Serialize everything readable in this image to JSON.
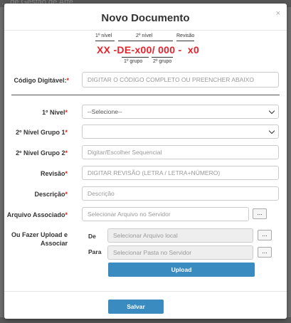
{
  "background": {
    "title": "... de Gestão de Arte"
  },
  "modal": {
    "title": "Novo Documento",
    "close": "×"
  },
  "code_guide": {
    "label_level1": "1º nível",
    "label_level2": "2º nível",
    "label_revision": "Revisão",
    "label_group1": "1º grupo",
    "label_group2": "2º grupo",
    "code": "XX -DE-x00/ 000 -  x0"
  },
  "form": {
    "codigo_digitavel": {
      "label": "Código Digitável:",
      "required": "*",
      "placeholder": "DIGITAR O CÓDIGO COMPLETO OU PREENCHER ABAIXO"
    },
    "nivel1": {
      "label": "1º Nível",
      "required": "*",
      "selected": "--Selecione--"
    },
    "nivel2_grupo1": {
      "label": "2º Nível Grupo 1",
      "required": "*",
      "selected": ""
    },
    "nivel2_grupo2": {
      "label": "2º Nível Grupo 2",
      "required": "*",
      "placeholder": "Digitar/Escolher Sequencial"
    },
    "revisao": {
      "label": "Revisão",
      "required": "*",
      "placeholder": "DIGITAR REVISÃO (LETRA / LETRA+NÚMERO)"
    },
    "descricao": {
      "label": "Descrição",
      "required": "*",
      "placeholder": "Descrição"
    },
    "arquivo_associado": {
      "label": "Arquivo Associado",
      "required": "*",
      "placeholder": "Selecionar Arquivo no Servidor",
      "browse": "..."
    },
    "upload": {
      "label_line1": "Ou Fazer Upload e",
      "label_line2": "Associar",
      "de_label": "De",
      "de_placeholder": "Selecionar Arquivo local",
      "de_browse": "...",
      "para_label": "Para",
      "para_placeholder": "Selecionar Pasta no Servidor",
      "para_browse": "...",
      "upload_button": "Upload"
    }
  },
  "footer": {
    "save_button": "Salvar"
  },
  "colors": {
    "accent": "#3a8cc0",
    "required": "#d9211b",
    "code": "#e8222b"
  }
}
